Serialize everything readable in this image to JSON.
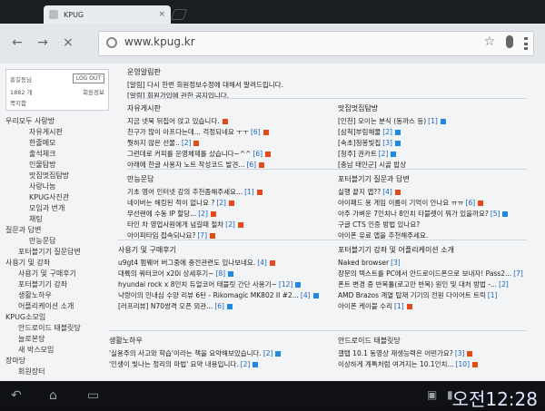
{
  "browser": {
    "tab_title": "KPUG",
    "tab_close": "×",
    "url": "www.kpug.kr",
    "nav": {
      "back": "←",
      "forward": "→",
      "stop": "×"
    }
  },
  "sidebar": {
    "login": {
      "name": "홍길동님",
      "logout_label": "LOG OUT",
      "points": "1882 개",
      "info": "회원정보",
      "msg": "쪽지함"
    },
    "items": [
      {
        "label": "우리모두 사랑방",
        "lvl": 0
      },
      {
        "label": "자유게시판",
        "lvl": 2
      },
      {
        "label": "한줄메모",
        "lvl": 2
      },
      {
        "label": "출석체크",
        "lvl": 2
      },
      {
        "label": "인물탐방",
        "lvl": 2
      },
      {
        "label": "맛집멋집탐방",
        "lvl": 2
      },
      {
        "label": "사랑나눔",
        "lvl": 2
      },
      {
        "label": "KPUG사진관",
        "lvl": 2
      },
      {
        "label": "모임과 번개",
        "lvl": 2
      },
      {
        "label": "채팅",
        "lvl": 2
      },
      {
        "label": "질문과 답변",
        "lvl": 0
      },
      {
        "label": "만능문답",
        "lvl": 2
      },
      {
        "label": "포터블기기 질문답변",
        "lvl": 1
      },
      {
        "label": "사용기 및 강좌",
        "lvl": 0
      },
      {
        "label": "사용기 및 구매후기",
        "lvl": 1
      },
      {
        "label": "포터블기기 강좌",
        "lvl": 1
      },
      {
        "label": "생활노하우",
        "lvl": 1
      },
      {
        "label": "어플리케이션 소개",
        "lvl": 1
      },
      {
        "label": "KPUG소모임",
        "lvl": 0
      },
      {
        "label": "안드로이드 태블릿당",
        "lvl": 1
      },
      {
        "label": "늘로본당",
        "lvl": 1
      },
      {
        "label": "새 박스모임",
        "lvl": 1
      },
      {
        "label": "장마당",
        "lvl": 0
      },
      {
        "label": "회원장터",
        "lvl": 1
      }
    ]
  },
  "sections": {
    "notice": {
      "title": "운영알림판",
      "rows": [
        "[알림] 다시 한번 회원정보수정에 대해서 말려드립니다.",
        "[알림] 회원가입에 관한 공지입니다."
      ]
    },
    "free": {
      "title": "자유게시판",
      "rows": [
        {
          "t": "지금 넷북 뒤집어 앉고 있습니다.",
          "c": ""
        },
        {
          "t": "친구가 많이 아프다는데... 걱정되네요 ㅜㅜ",
          "c": "[6]"
        },
        {
          "t": "뭣하지 않은 선물..",
          "c": "[2]"
        },
        {
          "t": "그런데로 커피를 운영체제를 샀습니다~^^",
          "c": "[6]"
        },
        {
          "t": "아래에 한글 사용자 노트 작성코드 발견...",
          "c": "[6]"
        }
      ]
    },
    "food": {
      "title": "맛집멋집탐방",
      "rows": [
        {
          "t": "[인천] 모이는 분식 (동까스 등)",
          "c": "[1]"
        },
        {
          "t": "[삼척]부림해물",
          "c": "[2]"
        },
        {
          "t": "[속초]청봉빛집",
          "c": "[3]"
        },
        {
          "t": "[청주] 권카트",
          "c": "[2]"
        },
        {
          "t": "[충남 태안군] 시골 밥상",
          "c": ""
        }
      ]
    },
    "qna": {
      "title": "만능문답",
      "rows": [
        {
          "t": "기초 영어 인터넷 강의 추천좀해주세요...",
          "c": "[1]"
        },
        {
          "t": "네이버는 해킹된 적이 없나요 ?",
          "c": "[2]"
        },
        {
          "t": "무선랜에 수동 IP 할당...",
          "c": "[2]"
        },
        {
          "t": "타인 차 영업사원에게 넘길때 절차",
          "c": "[2]"
        },
        {
          "t": "아이피타임 접속되나요?",
          "c": "[7]"
        }
      ]
    },
    "portable_qna": {
      "title": "포터블기기 질문과 답변",
      "rows": [
        {
          "t": "실행 끝지 앱??",
          "c": "[4]"
        },
        {
          "t": "아이패드 용 게임 이름이 기억이 안나요 ㅠㅠ",
          "c": "[6]"
        },
        {
          "t": "아주 가벼운 7인치나 8인치 타블렛이 뭐가 있을까요?",
          "c": "[5]"
        },
        {
          "t": "구글 CTS 인증 방법 있나요?",
          "c": ""
        },
        {
          "t": "아이폰 유료 앱을 추천해주세요.",
          "c": ""
        }
      ]
    },
    "review": {
      "title": "사용기 및 구매후기",
      "rows": [
        {
          "t": "u9gt4 펌웨어 버그중에 충전관련도 있나보네요.",
          "c": "[4]"
        },
        {
          "t": "대륙의 쿼터코어 x20i 상세후기~",
          "c": "[8]"
        },
        {
          "t": "hyundai rock x 8인치 듀얼코어 태블릿 간단 사용기~",
          "c": "[12]"
        },
        {
          "t": "낙랑이의 인내심 수양 리뷰 6탄 - Rikomagic MK802 II #2...",
          "c": "[4]"
        },
        {
          "t": "[러프리뷰] N70쌍격 오픈 외관...",
          "c": "[6]"
        }
      ]
    },
    "apps": {
      "title": "포터블기기 강좌 및 어플리케이션 소개",
      "rows": [
        {
          "t": "Naked browser",
          "c": "[3]"
        },
        {
          "t": "장문의 텍스트를 PC에서 안드로이드폰으로 보내자! Pass2...",
          "c": "[7]"
        },
        {
          "t": "폰트 변경 중 반복툴(로고만 반복) 원인 및 대처 방법 -...",
          "c": "[2]"
        },
        {
          "t": "AMD Brazos 계열 탑재 기기의 전원 다이어트 트릭",
          "c": "[1]"
        },
        {
          "t": "아이폰 케이블 수리",
          "c": "[1]"
        }
      ]
    },
    "life": {
      "title": "생활노하우",
      "rows": [
        {
          "t": "'실용주의 사고와 학습'이라는 책을 요약해보았습니다.",
          "c": "[2]"
        },
        {
          "t": "'인생이 빛나는 정리의 마법' 요약 내용입니다.",
          "c": "[2]"
        }
      ]
    },
    "android": {
      "title": "안드로이드 태블릿당",
      "rows": [
        {
          "t": "갤탭 10.1 동영상 재생능력은 어떤가요?",
          "c": "[3]"
        },
        {
          "t": "이상하게 계특처럼 여겨지는 10.1인치...",
          "c": "[10]"
        }
      ]
    }
  },
  "system": {
    "clock": "오전12:28"
  },
  "icons": {
    "back": "back-arrow-icon",
    "forward": "forward-arrow-icon",
    "stop": "stop-icon",
    "star": "star-icon",
    "mic": "mic-icon",
    "menu": "menu-icon"
  }
}
